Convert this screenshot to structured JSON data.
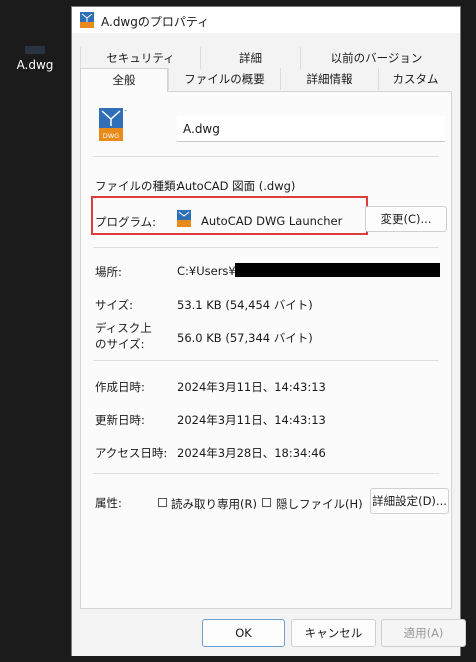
{
  "desktop": {
    "icon_label": "A.dwg"
  },
  "window": {
    "title": "A.dwgのプロパティ"
  },
  "tabs_back": [
    "セキュリティ",
    "詳細",
    "以前のバージョン"
  ],
  "tabs_front": [
    "全般",
    "ファイルの概要",
    "詳細情報",
    "カスタム"
  ],
  "active_tab": "全般",
  "file": {
    "name": "A.dwg",
    "icon_text": "DWG"
  },
  "fields": {
    "type_label": "ファイルの種類:",
    "type_value": "AutoCAD 図面 (.dwg)",
    "program_label": "プログラム:",
    "program_value": "AutoCAD DWG Launcher",
    "change_button": "変更(C)...",
    "location_label": "場所:",
    "location_value": "C:¥Users¥",
    "size_label": "サイズ:",
    "size_value": "53.1 KB (54,454 バイト)",
    "disk_size_label_1": "ディスク上",
    "disk_size_label_2": "のサイズ:",
    "disk_size_value": "56.0 KB (57,344 バイト)",
    "created_label": "作成日時:",
    "created_value": "2024年3月11日、14:43:13",
    "modified_label": "更新日時:",
    "modified_value": "2024年3月11日、14:43:13",
    "accessed_label": "アクセス日時:",
    "accessed_value": "2024年3月28日、18:34:46",
    "attributes_label": "属性:",
    "readonly_label": "読み取り専用(R)",
    "hidden_label": "隠しファイル(H)",
    "advanced_button": "詳細設定(D)..."
  },
  "buttons": {
    "ok": "OK",
    "cancel": "キャンセル",
    "apply": "適用(A)"
  },
  "colors": {
    "highlight": "#dc3c3c",
    "dwg_blue": "#2f6fb8",
    "dwg_orange": "#e88b1a"
  }
}
